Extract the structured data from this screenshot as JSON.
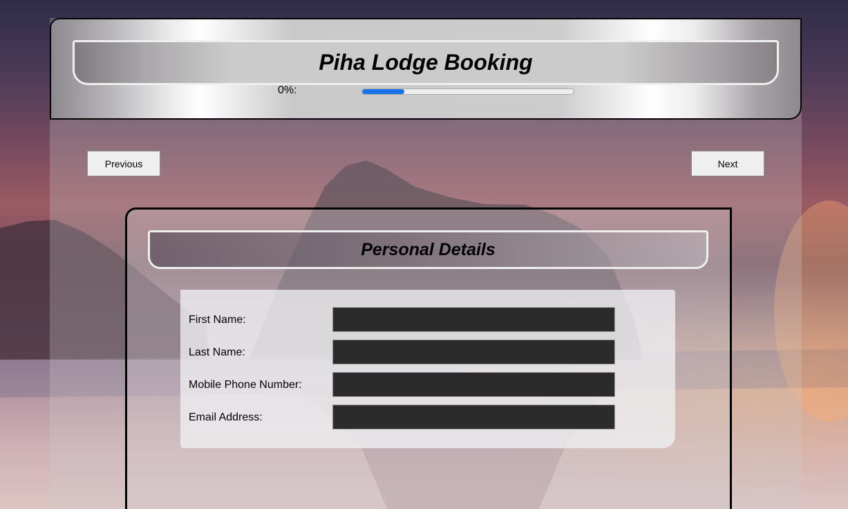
{
  "header": {
    "title": "Piha Lodge Booking",
    "progress_label": "0%:",
    "progress_fraction": 0.2,
    "progress_color": "#1a73e8"
  },
  "nav": {
    "previous_label": "Previous",
    "next_label": "Next"
  },
  "section": {
    "title": "Personal Details",
    "fields": [
      {
        "label": "First Name:",
        "value": ""
      },
      {
        "label": "Last Name:",
        "value": ""
      },
      {
        "label": "Mobile Phone Number:",
        "value": ""
      },
      {
        "label": "Email Address:",
        "value": ""
      }
    ]
  },
  "background": {
    "scene": "sunset beach with rock formation"
  }
}
